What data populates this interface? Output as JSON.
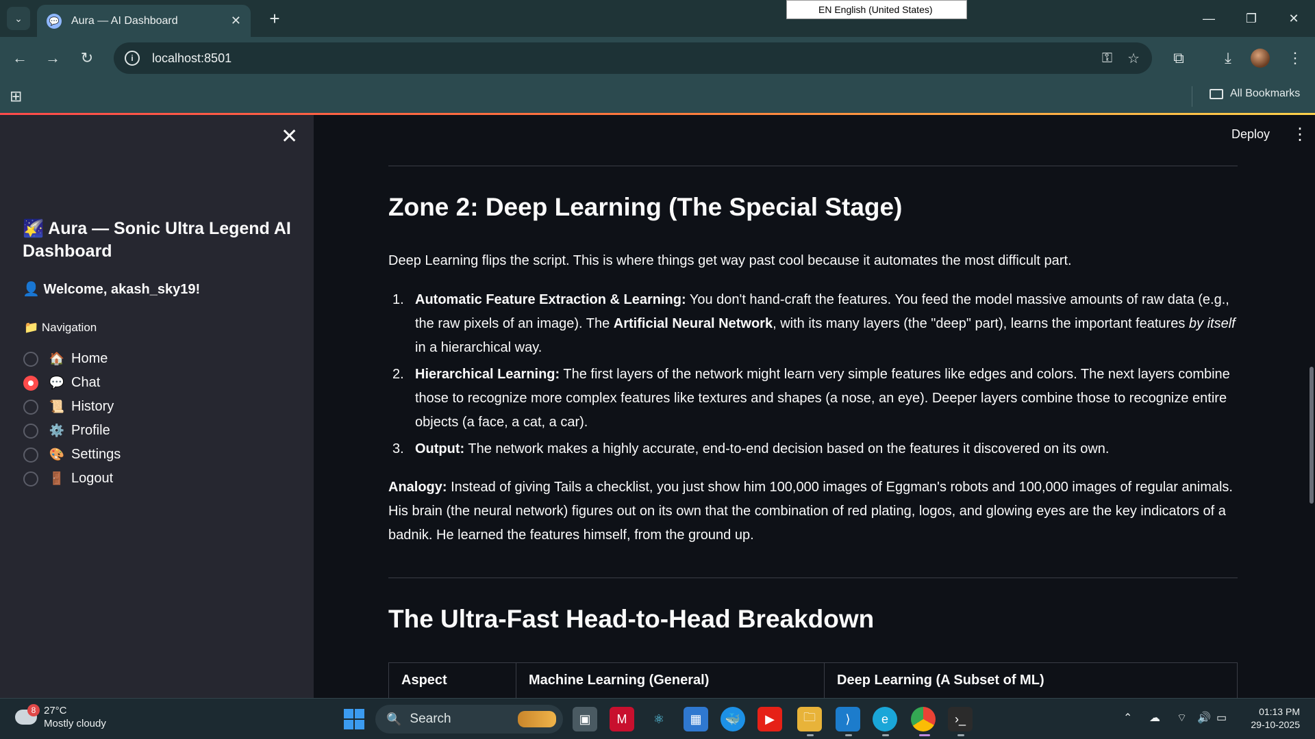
{
  "browser": {
    "tab_title": "Aura — AI Dashboard",
    "tab_close": "✕",
    "new_tab": "+",
    "ime_indicator": "EN English (United States)",
    "url": "localhost:8501",
    "all_bookmarks": "All Bookmarks"
  },
  "sidebar": {
    "close": "✕",
    "title_emoji": "🌠",
    "title": "Aura — Sonic Ultra Legend AI Dashboard",
    "welcome_emoji": "👤",
    "welcome": "Welcome, akash_sky19!",
    "nav_label_emoji": "📁",
    "nav_label": "Navigation",
    "nav_items": [
      {
        "emoji": "🏠",
        "label": "Home",
        "selected": false
      },
      {
        "emoji": "💬",
        "label": "Chat",
        "selected": true
      },
      {
        "emoji": "📜",
        "label": "History",
        "selected": false
      },
      {
        "emoji": "⚙️",
        "label": "Profile",
        "selected": false
      },
      {
        "emoji": "🎨",
        "label": "Settings",
        "selected": false
      },
      {
        "emoji": "🚪",
        "label": "Logout",
        "selected": false
      }
    ]
  },
  "header": {
    "deploy": "Deploy",
    "menu": "⋮"
  },
  "content": {
    "zone2_heading": "Zone 2: Deep Learning (The Special Stage)",
    "zone2_intro": "Deep Learning flips the script. This is where things get way past cool because it automates the most difficult part.",
    "list": [
      {
        "num": "1.",
        "bold": "Automatic Feature Extraction & Learning:",
        "text_a": " You don't hand-craft the features. You feed the model massive amounts of raw data (e.g., the raw pixels of an image). The ",
        "bold2": "Artificial Neural Network",
        "text_b": ", with its many layers (the \"deep\" part), learns the important features ",
        "italic": "by itself",
        "text_c": " in a hierarchical way."
      },
      {
        "num": "2.",
        "bold": "Hierarchical Learning:",
        "text_a": " The first layers of the network might learn very simple features like edges and colors. The next layers combine those to recognize more complex features like textures and shapes (a nose, an eye). Deeper layers combine those to recognize entire objects (a face, a cat, a car)."
      },
      {
        "num": "3.",
        "bold": "Output:",
        "text_a": " The network makes a highly accurate, end-to-end decision based on the features it discovered on its own."
      }
    ],
    "analogy_label": "Analogy:",
    "analogy_text": " Instead of giving Tails a checklist, you just show him 100,000 images of Eggman's robots and 100,000 images of regular animals. His brain (the neural network) figures out on its own that the combination of red plating, logos, and glowing eyes are the key indicators of a badnik. He learned the features himself, from the ground up.",
    "breakdown_heading": "The Ultra-Fast Head-to-Head Breakdown",
    "table_headers": [
      "Aspect",
      "Machine Learning (General)",
      "Deep Learning (A Subset of ML)"
    ]
  },
  "taskbar": {
    "weather_badge": "8",
    "temperature": "27°C",
    "condition": "Mostly cloudy",
    "search": "Search",
    "time": "01:13 PM",
    "date": "29-10-2025"
  }
}
